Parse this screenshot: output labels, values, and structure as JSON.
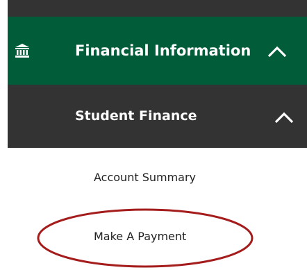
{
  "menu": {
    "financial_information": {
      "label": "Financial Information",
      "icon": "bank-icon",
      "expanded": true
    },
    "student_finance": {
      "label": "Student Finance",
      "expanded": true,
      "items": [
        {
          "label": "Account Summary"
        },
        {
          "label": "Make A Payment"
        }
      ]
    }
  },
  "colors": {
    "financial_bg": "#005c39",
    "student_finance_bg": "#333333",
    "highlight": "#a51c1c"
  }
}
